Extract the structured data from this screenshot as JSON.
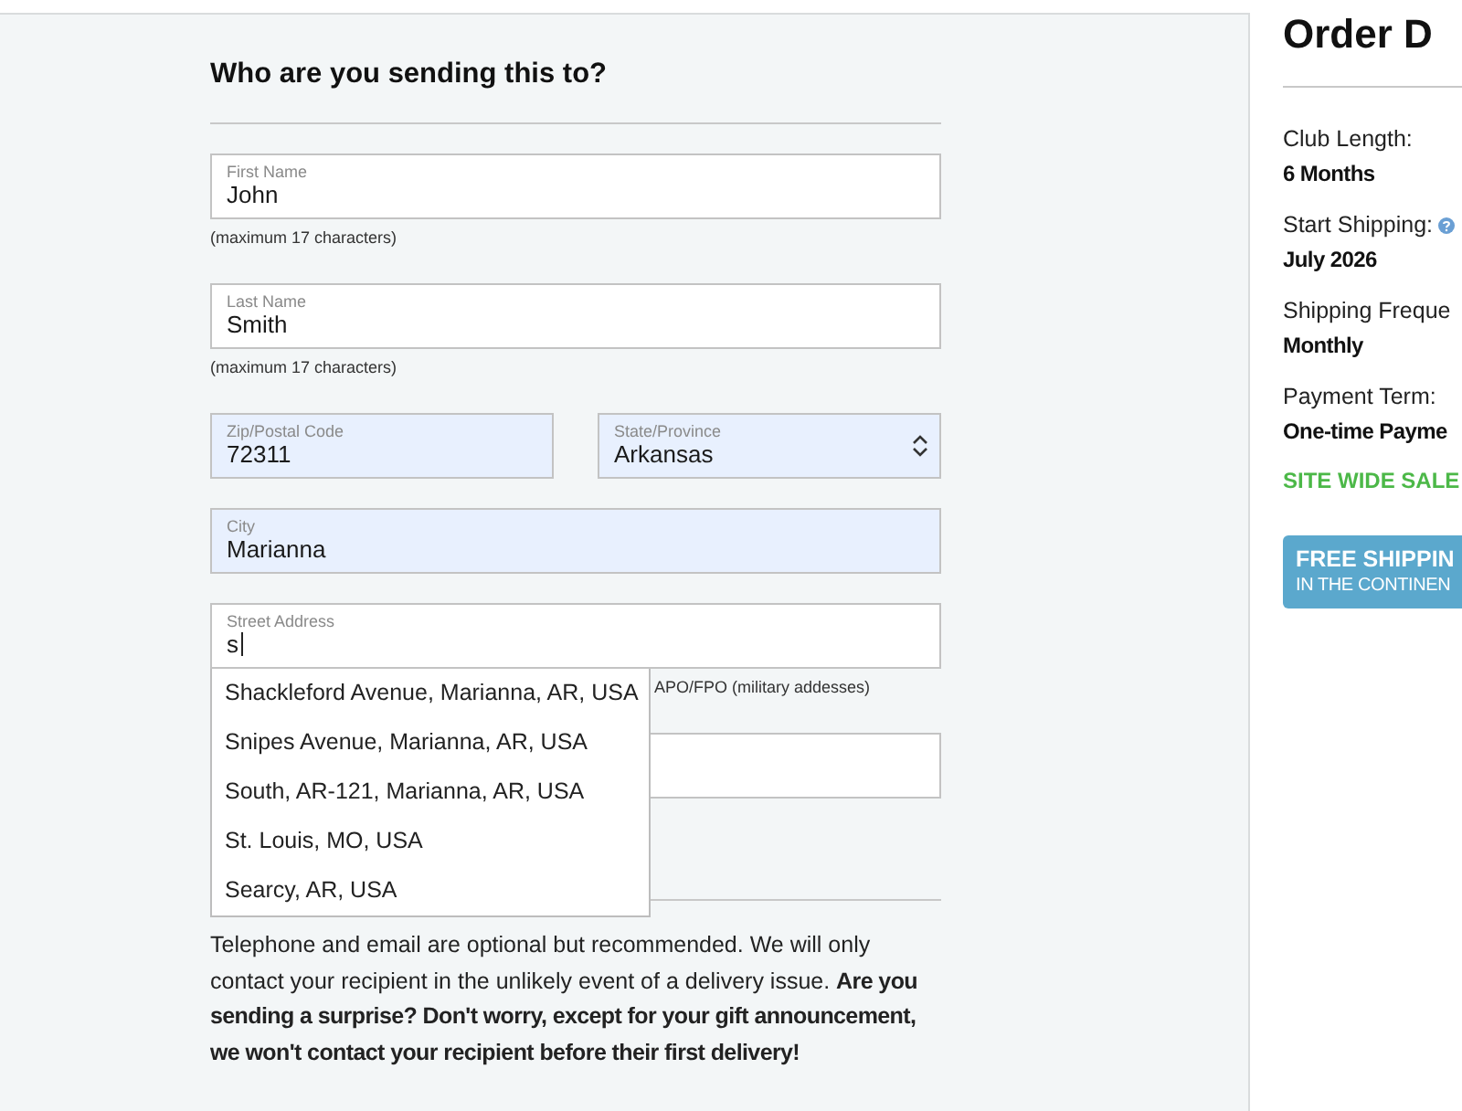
{
  "form": {
    "title": "Who are you sending this to?",
    "rows": [
      {
        "fields": [
          {
            "kind": "text",
            "label": "First Name",
            "value": "John",
            "autofilled": false,
            "focused": false
          }
        ],
        "hint": "(maximum 17 characters)"
      },
      {
        "fields": [
          {
            "kind": "text",
            "label": "Last Name",
            "value": "Smith",
            "autofilled": false,
            "focused": false
          }
        ],
        "hint": "(maximum 17 characters)"
      },
      {
        "fields": [
          {
            "kind": "text",
            "label": "Zip/Postal Code",
            "value": "72311",
            "autofilled": true,
            "focused": false
          },
          {
            "kind": "select",
            "label": "State/Province",
            "value": "Arkansas",
            "autofilled": true,
            "focused": false
          }
        ]
      },
      {
        "fields": [
          {
            "kind": "text",
            "label": "City",
            "value": "Marianna",
            "autofilled": true,
            "focused": false
          }
        ]
      },
      {
        "fields": [
          {
            "kind": "text",
            "label": "Street Address",
            "value": "s",
            "autofilled": false,
            "focused": true
          }
        ],
        "hint": "APO/FPO (military addesses)",
        "suggestions": [
          "Shackleford Avenue, Marianna, AR, USA",
          "Snipes Avenue, Marianna, AR, USA",
          "South, AR-121, Marianna, AR, USA",
          "St. Louis, MO, USA",
          "Searcy, AR, USA"
        ]
      },
      {
        "fields": [
          {
            "kind": "text",
            "autofilled": false
          }
        ]
      }
    ],
    "notice": "Telephone and email are optional but recommended. We will only contact your recipient in the unlikely event of a delivery issue. **Are you sending a surprise? Don't worry, except for your gift announcement, we won't contact your recipient before their first delivery!**"
  },
  "order": {
    "title": "Order D",
    "details": [
      {
        "label": "Club Length:",
        "value": "6 Months",
        "info": false
      },
      {
        "label": "Start Shipping:",
        "value": "July 2026",
        "info": true
      },
      {
        "label": "Shipping Freque",
        "value": "Monthly",
        "info": false
      },
      {
        "label": "Payment Term:",
        "value": "One-time Payme",
        "info": false
      }
    ],
    "sale_note": "SITE WIDE SALE",
    "shipping_banner": {
      "line_1": "FREE SHIPPIN",
      "line_2": "IN THE CONTINEN"
    }
  }
}
